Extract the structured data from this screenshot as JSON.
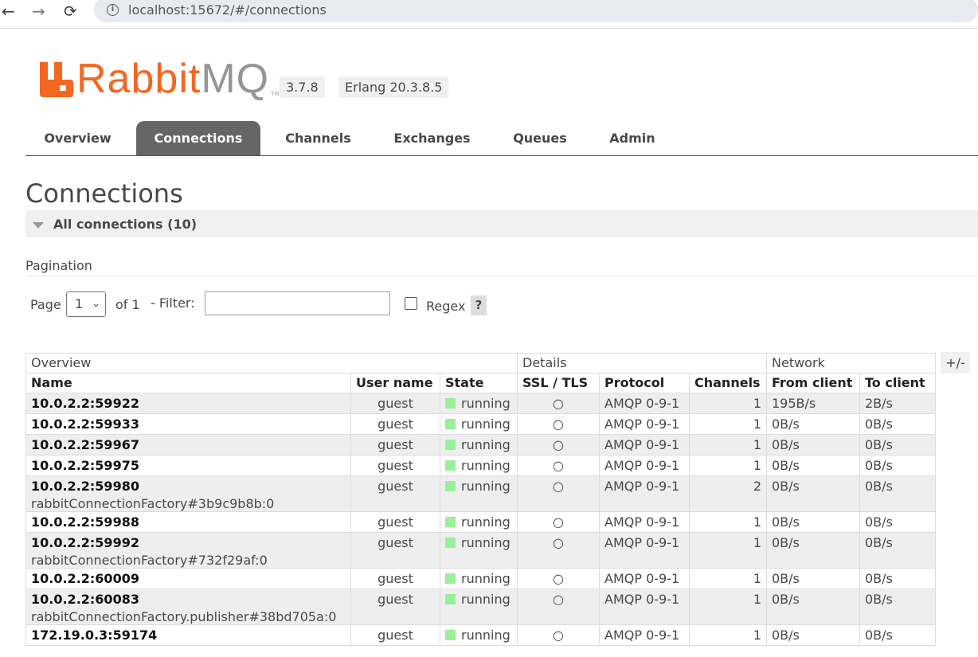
{
  "browser": {
    "back_icon": "←",
    "forward_icon": "→",
    "reload_icon": "⟳",
    "info_icon": "i",
    "url": "localhost:15672/#/connections"
  },
  "header": {
    "logo_primary": "Rabbit",
    "logo_secondary": "MQ",
    "logo_tm": "TM",
    "version": "3.7.8",
    "erlang": "Erlang 20.3.8.5"
  },
  "tabs": [
    {
      "label": "Overview"
    },
    {
      "label": "Connections",
      "active": true
    },
    {
      "label": "Channels"
    },
    {
      "label": "Exchanges"
    },
    {
      "label": "Queues"
    },
    {
      "label": "Admin"
    }
  ],
  "page": {
    "title": "Connections",
    "section_label": "All connections (10)",
    "pagination_label": "Pagination",
    "page_label": "Page",
    "page_value": "1",
    "page_chevron": "⌄",
    "of_label": "of 1",
    "filter_label": "- Filter:",
    "filter_value": "",
    "regex_label": "Regex",
    "help_label": "?",
    "columns_toggle": "+/-"
  },
  "table": {
    "groups": [
      "Overview",
      "Details",
      "Network"
    ],
    "columns": [
      "Name",
      "User name",
      "State",
      "SSL / TLS",
      "Protocol",
      "Channels",
      "From client",
      "To client"
    ],
    "rows": [
      {
        "name": "10.0.2.2:59922",
        "sub": "",
        "user": "guest",
        "state": "running",
        "ssl": "○",
        "protocol": "AMQP 0-9-1",
        "channels": "1",
        "from": "195B/s",
        "to": "2B/s"
      },
      {
        "name": "10.0.2.2:59933",
        "sub": "",
        "user": "guest",
        "state": "running",
        "ssl": "○",
        "protocol": "AMQP 0-9-1",
        "channels": "1",
        "from": "0B/s",
        "to": "0B/s"
      },
      {
        "name": "10.0.2.2:59967",
        "sub": "",
        "user": "guest",
        "state": "running",
        "ssl": "○",
        "protocol": "AMQP 0-9-1",
        "channels": "1",
        "from": "0B/s",
        "to": "0B/s"
      },
      {
        "name": "10.0.2.2:59975",
        "sub": "",
        "user": "guest",
        "state": "running",
        "ssl": "○",
        "protocol": "AMQP 0-9-1",
        "channels": "1",
        "from": "0B/s",
        "to": "0B/s"
      },
      {
        "name": "10.0.2.2:59980",
        "sub": "rabbitConnectionFactory#3b9c9b8b:0",
        "user": "guest",
        "state": "running",
        "ssl": "○",
        "protocol": "AMQP 0-9-1",
        "channels": "2",
        "from": "0B/s",
        "to": "0B/s"
      },
      {
        "name": "10.0.2.2:59988",
        "sub": "",
        "user": "guest",
        "state": "running",
        "ssl": "○",
        "protocol": "AMQP 0-9-1",
        "channels": "1",
        "from": "0B/s",
        "to": "0B/s"
      },
      {
        "name": "10.0.2.2:59992",
        "sub": "rabbitConnectionFactory#732f29af:0",
        "user": "guest",
        "state": "running",
        "ssl": "○",
        "protocol": "AMQP 0-9-1",
        "channels": "1",
        "from": "0B/s",
        "to": "0B/s"
      },
      {
        "name": "10.0.2.2:60009",
        "sub": "",
        "user": "guest",
        "state": "running",
        "ssl": "○",
        "protocol": "AMQP 0-9-1",
        "channels": "1",
        "from": "0B/s",
        "to": "0B/s"
      },
      {
        "name": "10.0.2.2:60083",
        "sub": "rabbitConnectionFactory.publisher#38bd705a:0",
        "user": "guest",
        "state": "running",
        "ssl": "○",
        "protocol": "AMQP 0-9-1",
        "channels": "1",
        "from": "0B/s",
        "to": "0B/s"
      },
      {
        "name": "172.19.0.3:59174",
        "sub": "",
        "user": "guest",
        "state": "running",
        "ssl": "○",
        "protocol": "AMQP 0-9-1",
        "channels": "1",
        "from": "0B/s",
        "to": "0B/s"
      }
    ]
  },
  "colors": {
    "brand_orange": "#f26722",
    "brand_grey": "#959595",
    "active_tab": "#666666",
    "running_green": "#98f098",
    "row_shade": "#eeeeee"
  }
}
